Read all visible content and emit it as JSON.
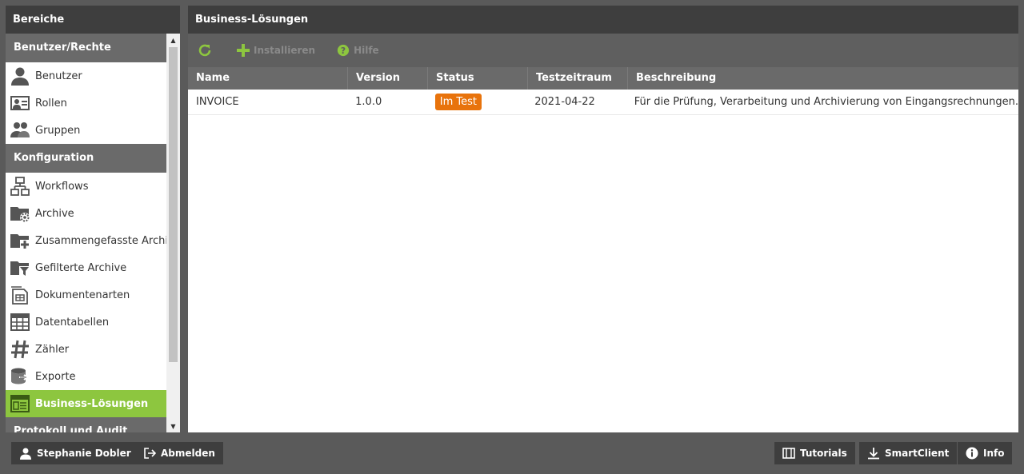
{
  "left": {
    "title": "Bereiche",
    "sections": {
      "users": {
        "title": "Benutzer/Rechte",
        "items": [
          "Benutzer",
          "Rollen",
          "Gruppen"
        ]
      },
      "config": {
        "title": "Konfiguration",
        "items": [
          "Workflows",
          "Archive",
          "Zusammengefasste Archive",
          "Gefilterte Archive",
          "Dokumentenarten",
          "Datentabellen",
          "Zähler",
          "Exporte",
          "Business-Lösungen"
        ]
      },
      "next_cut": "Protokoll und Audit"
    }
  },
  "main": {
    "title": "Business-Lösungen",
    "toolbar": {
      "refresh_icon": "refresh-icon",
      "install_label": "Installieren",
      "help_label": "Hilfe"
    },
    "columns": [
      "Name",
      "Version",
      "Status",
      "Testzeitraum",
      "Beschreibung"
    ],
    "rows": [
      {
        "name": "INVOICE",
        "version": "1.0.0",
        "status": "Im Test",
        "testzeitraum": "2021-04-22",
        "beschreibung": "Für die Prüfung, Verarbeitung und Archivierung von Eingangsrechnungen."
      }
    ]
  },
  "bottom": {
    "user": "Stephanie Dobler",
    "logout": "Abmelden",
    "tutorials": "Tutorials",
    "smartclient": "SmartClient",
    "info": "Info"
  },
  "colors": {
    "accent": "#8dc63f",
    "status_test": "#e8730c",
    "header_dark": "#3e3e3e"
  }
}
